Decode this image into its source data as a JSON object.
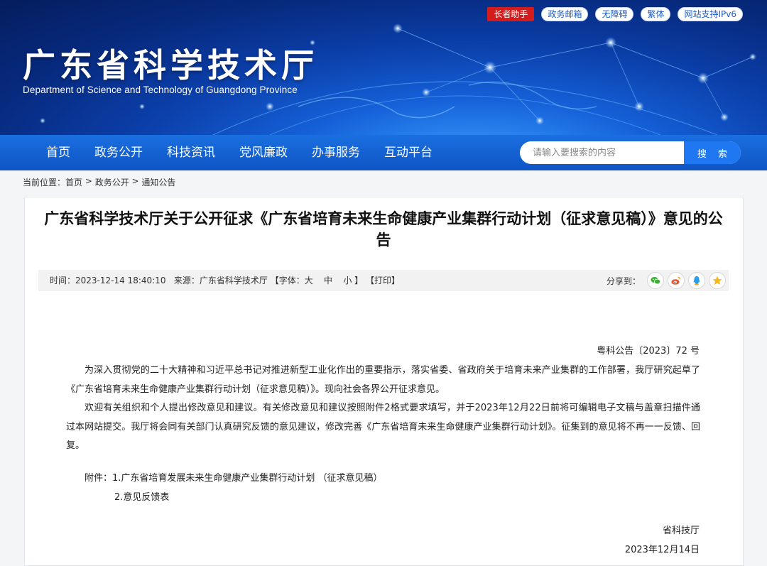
{
  "header": {
    "title": "广东省科学技术厅",
    "subtitle": "Department of Science and Technology of Guangdong Province",
    "top_links": [
      "长者助手",
      "政务邮箱",
      "无障碍",
      "繁体",
      "网站支持IPv6"
    ]
  },
  "nav": {
    "items": [
      "首页",
      "政务公开",
      "科技资讯",
      "党风廉政",
      "办事服务",
      "互动平台"
    ],
    "search_placeholder": "请输入要搜索的内容",
    "search_button": "搜 索"
  },
  "breadcrumb": {
    "prefix": "当前位置：",
    "items": [
      "首页",
      "政务公开",
      "通知公告"
    ],
    "separator": " > "
  },
  "article": {
    "title": "广东省科学技术厅关于公开征求《广东省培育未来生命健康产业集群行动计划（征求意见稿）》意见的公告",
    "meta": {
      "time": "时间：2023-12-14 18:40:10",
      "source": "来源：广东省科学技术厅",
      "font_prefix": "【字体：",
      "font_large": "大",
      "font_medium": "中",
      "font_small": "小",
      "font_suffix": "】",
      "print": "【打印】",
      "share_label": "分享到："
    },
    "share_icons": [
      "wechat-icon",
      "weibo-icon",
      "qq-icon",
      "qzone-icon"
    ],
    "doc_no": "粤科公告〔2023〕72 号",
    "paragraphs": [
      "为深入贯彻党的二十大精神和习近平总书记对推进新型工业化作出的重要指示，落实省委、省政府关于培育未来产业集群的工作部署，我厅研究起草了《广东省培育未来生命健康产业集群行动计划（征求意见稿）》。现向社会各界公开征求意见。",
      "欢迎有关组织和个人提出修改意见和建议。有关修改意见和建议按照附件2格式要求填写，并于2023年12月22日前将可编辑电子文稿与盖章扫描件通过本网站提交。我厅将会同有关部门认真研究反馈的意见建议，修改完善《广东省培育未来生命健康产业集群行动计划》。征集到的意见将不再一一反馈、回复。"
    ],
    "attachments_label": "附件：",
    "attachments": [
      "1.广东省培育发展未来生命健康产业集群行动计划 （征求意见稿）",
      "2.意见反馈表"
    ],
    "signer": "省科技厅",
    "date": "2023年12月14日"
  },
  "colors": {
    "nav_blue": "#1565d8",
    "elder_red": "#d41c1c",
    "search_button": "#1f78f2"
  }
}
